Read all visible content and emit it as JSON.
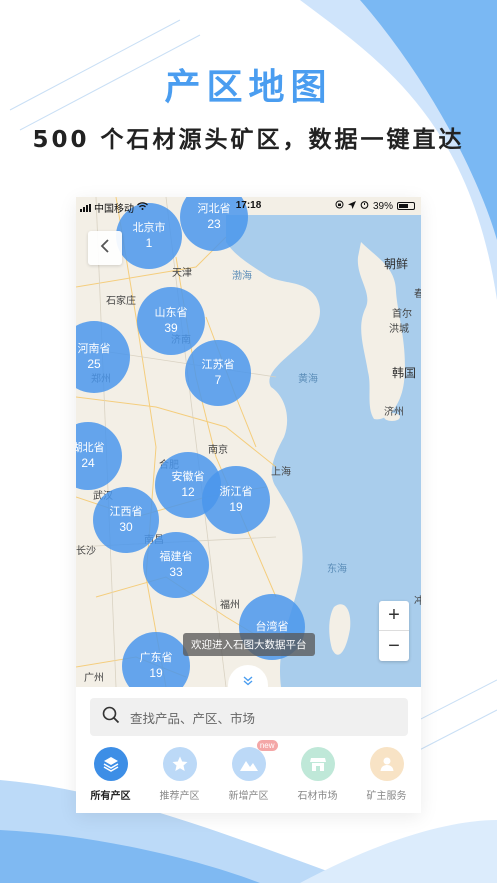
{
  "headline": {
    "title": "产区地图",
    "subtitle": "500 个石材源头矿区，数据一键直达"
  },
  "status_bar": {
    "carrier": "中国移动",
    "time": "17:18",
    "battery": "39%"
  },
  "map": {
    "labels": [
      {
        "text": "天津",
        "type": "city"
      },
      {
        "text": "石家庄",
        "type": "city"
      },
      {
        "text": "渤海",
        "type": "sea"
      },
      {
        "text": "朝鲜",
        "type": "country"
      },
      {
        "text": "首尔",
        "type": "city"
      },
      {
        "text": "洪城",
        "type": "city"
      },
      {
        "text": "韩国",
        "type": "country"
      },
      {
        "text": "黄海",
        "type": "sea"
      },
      {
        "text": "济州",
        "type": "city"
      },
      {
        "text": "济南",
        "type": "city"
      },
      {
        "text": "郑州",
        "type": "city"
      },
      {
        "text": "南京",
        "type": "city"
      },
      {
        "text": "合肥",
        "type": "city"
      },
      {
        "text": "上海",
        "type": "city"
      },
      {
        "text": "武汉",
        "type": "city"
      },
      {
        "text": "长沙",
        "type": "city"
      },
      {
        "text": "南昌",
        "type": "city"
      },
      {
        "text": "东海",
        "type": "sea"
      },
      {
        "text": "福州",
        "type": "city"
      },
      {
        "text": "广州",
        "type": "city"
      },
      {
        "text": "冲",
        "type": "city"
      },
      {
        "text": "春",
        "type": "city"
      }
    ],
    "clusters": [
      {
        "name": "北京市",
        "count": "1"
      },
      {
        "name": "河北省",
        "count": "23"
      },
      {
        "name": "山东省",
        "count": "39"
      },
      {
        "name": "河南省",
        "count": "25"
      },
      {
        "name": "江苏省",
        "count": "7"
      },
      {
        "name": "湖北省",
        "count": "24"
      },
      {
        "name": "安徽省",
        "count": "12"
      },
      {
        "name": "浙江省",
        "count": "19"
      },
      {
        "name": "江西省",
        "count": "30"
      },
      {
        "name": "福建省",
        "count": "33"
      },
      {
        "name": "台湾省",
        "count": ""
      },
      {
        "name": "广东省",
        "count": "19"
      }
    ],
    "toast": "欢迎进入石图大数据平台",
    "zoom_in": "+",
    "zoom_out": "−"
  },
  "search": {
    "placeholder": "查找产品、产区、市场"
  },
  "tabs": [
    {
      "label": "所有产区",
      "color": "#3d8ee6",
      "icon": "layers-icon",
      "active": true
    },
    {
      "label": "推荐产区",
      "color": "#bcd9f7",
      "icon": "star-icon",
      "active": false
    },
    {
      "label": "新增产区",
      "color": "#bcd9f7",
      "icon": "mountain-icon",
      "active": false,
      "badge": "new"
    },
    {
      "label": "石材市场",
      "color": "#bfe8d8",
      "icon": "store-icon",
      "active": false
    },
    {
      "label": "矿主服务",
      "color": "#f8e3c5",
      "icon": "person-icon",
      "active": false
    }
  ],
  "colors": {
    "accent": "#4a9df0",
    "cluster": "#4a97ec"
  }
}
